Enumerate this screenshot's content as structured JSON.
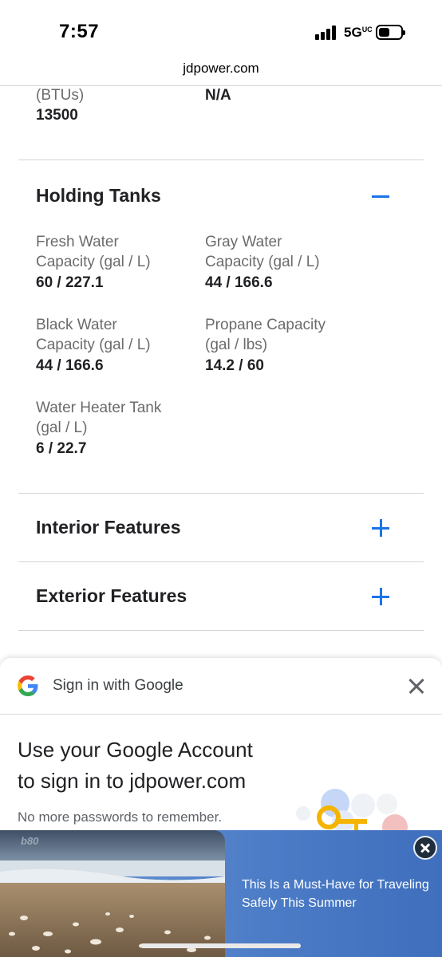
{
  "status_bar": {
    "time": "7:57",
    "network": "5G",
    "network_suffix": "UC"
  },
  "browser": {
    "url": "jdpower.com"
  },
  "top_spec": {
    "left_label": "(BTUs)",
    "left_value": "13500",
    "right_value": "N/A"
  },
  "holding_tanks": {
    "title": "Holding Tanks",
    "toggle_icon": "minus-icon",
    "specs": [
      {
        "label_line1": "Fresh Water",
        "label_line2": "Capacity (gal / L)",
        "value": "60 / 227.1"
      },
      {
        "label_line1": "Gray Water",
        "label_line2": "Capacity (gal / L)",
        "value": "44 / 166.6"
      },
      {
        "label_line1": "Black Water",
        "label_line2": "Capacity (gal / L)",
        "value": "44 / 166.6"
      },
      {
        "label_line1": "Propane Capacity",
        "label_line2": "(gal / lbs)",
        "value": "14.2 / 60"
      },
      {
        "label_line1": "Water Heater Tank",
        "label_line2": "(gal / L)",
        "value": "6 / 22.7"
      }
    ]
  },
  "sections": [
    {
      "title": "Interior Features",
      "toggle_icon": "plus-icon"
    },
    {
      "title": "Exterior Features",
      "toggle_icon": "plus-icon"
    }
  ],
  "google_signin": {
    "header_title": "Sign in with Google",
    "headline_line1": "Use your Google Account",
    "headline_line2": "to sign in to jdpower.com",
    "subtext": "No more passwords to remember."
  },
  "ad": {
    "text_line1": "This Is a Must-Have for Traveling",
    "text_line2": "Safely This Summer",
    "watermark": "b80"
  },
  "colors": {
    "accent": "#1a73e8",
    "label": "#6b6b6b",
    "text": "#202124"
  }
}
